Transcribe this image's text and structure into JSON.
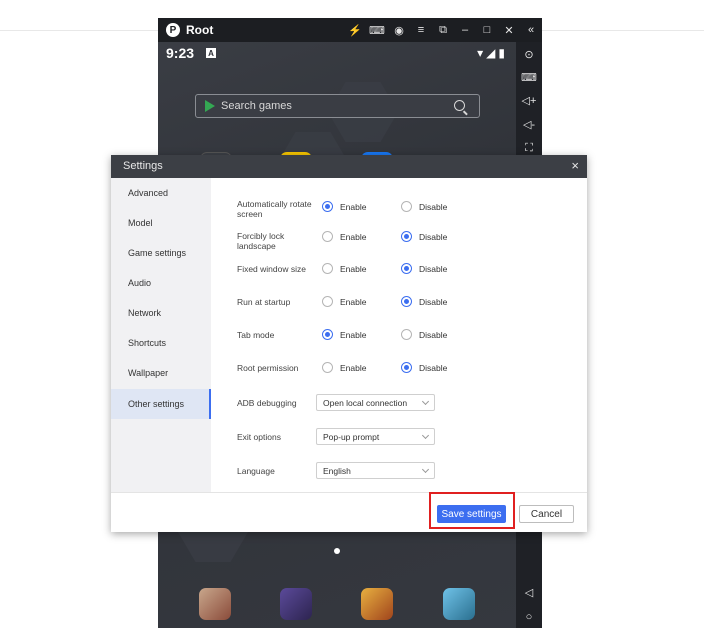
{
  "emulator": {
    "title": "Root",
    "logo_glyph": "P",
    "titlebar_icons": [
      "bolt-icon",
      "gamepad-icon",
      "account-icon",
      "menu-icon",
      "screen-icon",
      "minimize-icon",
      "maximize-icon",
      "close-icon",
      "collapse-icon"
    ],
    "status_time": "9:23",
    "status_badge": "A",
    "search_placeholder": "Search games",
    "rail_icons": [
      "settings-icon",
      "keyboard-icon",
      "volume-up-icon",
      "volume-down-icon",
      "screenshot-icon",
      "back-icon",
      "home-icon"
    ]
  },
  "dialog": {
    "title": "Settings",
    "close_glyph": "×",
    "sidebar": [
      "Advanced",
      "Model",
      "Game settings",
      "Audio",
      "Network",
      "Shortcuts",
      "Wallpaper",
      "Other settings"
    ],
    "active_item": "Other settings",
    "enable_label": "Enable",
    "disable_label": "Disable",
    "toggles": [
      {
        "label": "Automatically rotate screen",
        "value": "Enable"
      },
      {
        "label": "Forcibly lock landscape",
        "value": "Disable"
      },
      {
        "label": "Fixed window size",
        "value": "Disable"
      },
      {
        "label": "Run at startup",
        "value": "Disable"
      },
      {
        "label": "Tab mode",
        "value": "Enable"
      },
      {
        "label": "Root permission",
        "value": "Disable"
      }
    ],
    "selects": [
      {
        "label": "ADB debugging",
        "value": "Open local connection"
      },
      {
        "label": "Exit options",
        "value": "Pop-up prompt"
      },
      {
        "label": "Language",
        "value": "English"
      }
    ],
    "save_label": "Save settings",
    "cancel_label": "Cancel"
  },
  "colors": {
    "accent": "#3c6ef0",
    "highlight": "#e02020"
  }
}
